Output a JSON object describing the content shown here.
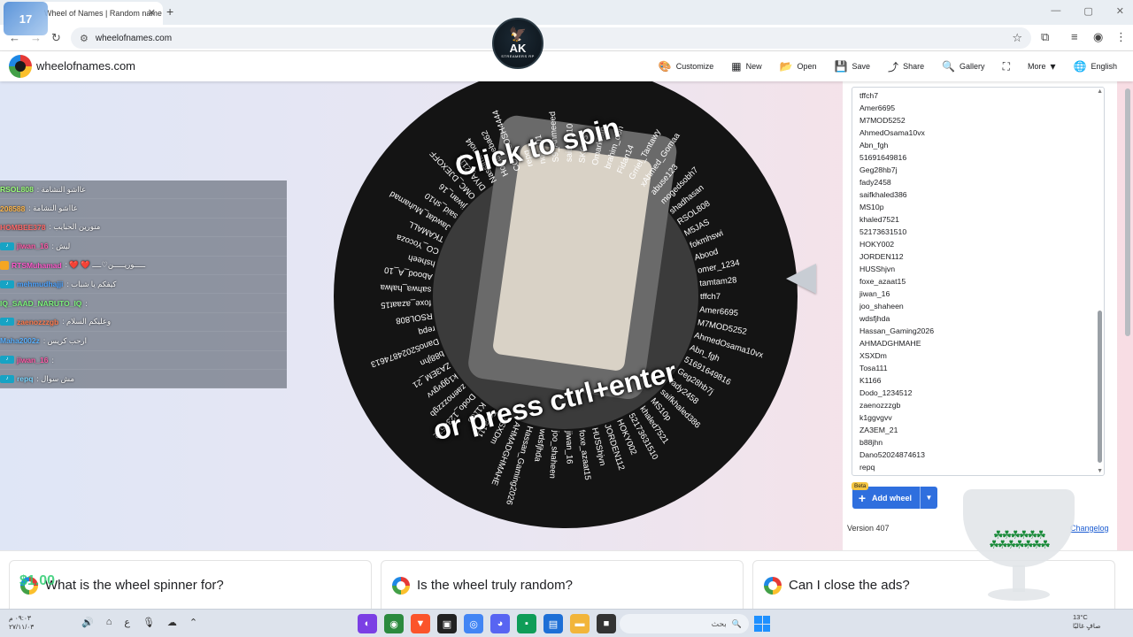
{
  "browser": {
    "tab_title": "Wheel of Names | Random name picker",
    "tab_close": "✕",
    "new_tab": "+",
    "url": "wheelofnames.com",
    "window_controls": [
      "—",
      "▢",
      "✕"
    ],
    "stream_badge": "17"
  },
  "overlay_logo": {
    "text": "AK",
    "sub": "STREAMERS RP"
  },
  "site": {
    "name": "wheelofnames.com",
    "menu": [
      {
        "icon": "palette-icon",
        "glyph": "🎨",
        "label": "Customize"
      },
      {
        "icon": "new-icon",
        "glyph": "▦",
        "label": "New"
      },
      {
        "icon": "folder-open-icon",
        "glyph": "📂",
        "label": "Open"
      },
      {
        "icon": "save-icon",
        "glyph": "💾",
        "label": "Save"
      },
      {
        "icon": "share-icon",
        "glyph": "⤴",
        "label": "Share"
      },
      {
        "icon": "search-icon",
        "glyph": "🔍",
        "label": "Gallery"
      },
      {
        "icon": "fullscreen-icon",
        "glyph": "⛶",
        "label": ""
      },
      {
        "icon": "more-icon",
        "glyph": "▾",
        "label": "More"
      },
      {
        "icon": "globe-icon",
        "glyph": "🌐",
        "label": "English"
      }
    ]
  },
  "wheel": {
    "spin_line1": "Click to spin",
    "spin_line2": "or press ctrl+enter",
    "segments": [
      "tffch7",
      "Amer6695",
      "M7MOD5252",
      "AhmedOsama10vx",
      "Abn_fgh",
      "51691649816",
      "Geg28hb7j",
      "fady2458",
      "saifkhaled386",
      "MS10p",
      "khaled7521",
      "52173631510",
      "HOKY002",
      "JORDEN112",
      "HUSShjvn",
      "foxe_azaat15",
      "jiwan_16",
      "joo_shaheen",
      "wdsfjhda",
      "Hassan_Gaming2026",
      "AHMADGHMAHE",
      "XSXDm",
      "Tosa111",
      "K1166",
      "Dodo_1234512",
      "zaenozzzgb",
      "k1ggvgvv",
      "ZA3EM_21",
      "b88jhn",
      "Dano52024874613",
      "repq",
      "RSOL808",
      "foxe_azaat15",
      "sahwa_halwa",
      "Abood_A_10",
      "hsheeh",
      "CO_Yocoza",
      "TKAMALL",
      "Jawdat_Muhamad",
      "said_sh10",
      "jiwan_16",
      "OMC_DJEXOFF",
      "DIYA_2112",
      "Nassimamol4",
      "Homsheba62",
      "CO_ALOSH4444",
      "repq",
      "nqw_01",
      "S9_Ahmeeed",
      "said_sh10",
      "SKOP3",
      "Omarkhab",
      "brahim_don",
      "Fidan14",
      "Grriel_Tantawy",
      "xAhmed_Gomaa",
      "abuse123",
      "mogedsobh7",
      "shadhasan",
      "RSOL808",
      "M5JAS",
      "fokmhswi",
      "Abood",
      "omer_1234",
      "tamtam28"
    ]
  },
  "chat": [
    {
      "user": "RSOL808",
      "msg": ": عااشو النشامة",
      "color": "#9bff7a",
      "icon": ""
    },
    {
      "user": "208588",
      "msg": ": عااشو النشامة",
      "color": "#ffb84d",
      "icon": ""
    },
    {
      "user": "HOMBEE378",
      "msg": ": منورين الحبايب",
      "color": "#ff6b6b",
      "icon": ""
    },
    {
      "user": "jiwan_16",
      "msg": ": ليش",
      "color": "#ff5aa8",
      "icon": "tiktok"
    },
    {
      "user": "RTSMuhamad",
      "msg": ": ❤️ ❤️ ـــــوريـــــن♡ــــ",
      "color": "#ff5acd",
      "icon": "badge"
    },
    {
      "user": "mehmudhajji",
      "msg": ": كيفكم يا شباب",
      "color": "#4da3ff",
      "icon": "tiktok"
    },
    {
      "user": "IQ_SAAD_NARUTO_IQ",
      "msg": ":",
      "color": "#7cf27c",
      "icon": ""
    },
    {
      "user": "zaenozzzgb",
      "msg": ": وعليكم السلام",
      "color": "#ff7a4d",
      "icon": "tiktok"
    },
    {
      "user": "Maha2002z",
      "msg": ": ارحب كريس",
      "color": "#5ab1ff",
      "icon": ""
    },
    {
      "user": "jiwan_16",
      "msg": ":",
      "color": "#ff5aa8",
      "icon": "tiktok"
    },
    {
      "user": "repq",
      "msg": ": مش سوال",
      "color": "#7ad6ff",
      "icon": "tiktok"
    }
  ],
  "panel": {
    "entries": [
      "tffch7",
      "Amer6695",
      "M7MOD5252",
      "AhmedOsama10vx",
      "Abn_fgh",
      "51691649816",
      "Geg28hb7j",
      "fady2458",
      "saifkhaled386",
      "MS10p",
      "khaled7521",
      "52173631510",
      "HOKY002",
      "JORDEN112",
      "HUSShjvn",
      "foxe_azaat15",
      "jiwan_16",
      "joo_shaheen",
      "wdsfjhda",
      "Hassan_Gaming2026",
      "AHMADGHMAHE",
      "XSXDm",
      "Tosa111",
      "K1166",
      "Dodo_1234512",
      "zaenozzzgb",
      "k1ggvgvv",
      "ZA3EM_21",
      "b88jhn",
      "Dano52024874613",
      "repq"
    ],
    "beta": "Beta",
    "add_wheel": "Add wheel",
    "version": "Version 407",
    "changelog": "Changelog"
  },
  "faq": [
    {
      "q": "What is the wheel spinner for?"
    },
    {
      "q": "Is the wheel truly random?"
    },
    {
      "q": "Can I close the ads?"
    }
  ],
  "donation": "$1.00",
  "taskbar": {
    "search_placeholder": "بحث",
    "weather_temp": "13°C",
    "weather_desc": "صافٍ غالبًا",
    "clock_time": "٠٩:٠٣ م",
    "clock_date": "٢٧/١١/٠٣"
  }
}
